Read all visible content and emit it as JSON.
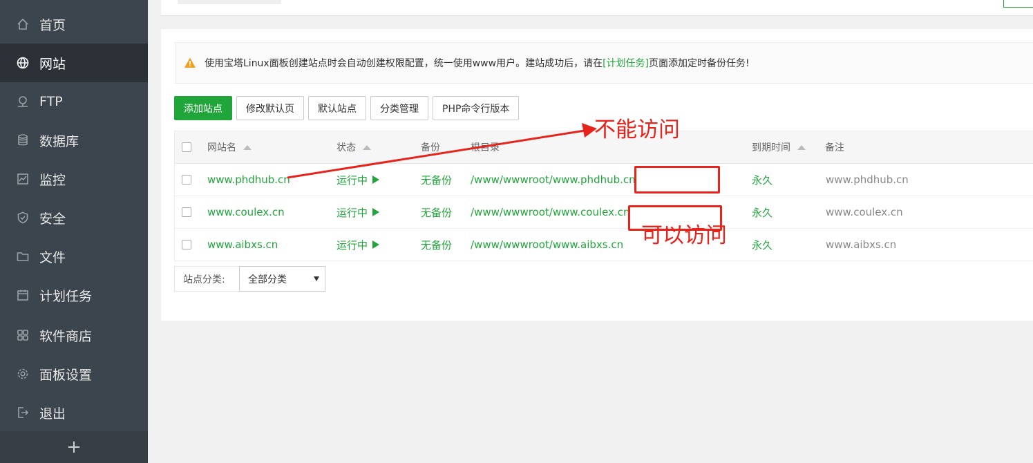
{
  "sidebar": {
    "items": [
      {
        "label": "首页",
        "icon": "home-icon"
      },
      {
        "label": "网站",
        "icon": "globe-icon",
        "active": true
      },
      {
        "label": "FTP",
        "icon": "ftp-icon"
      },
      {
        "label": "数据库",
        "icon": "database-icon"
      },
      {
        "label": "监控",
        "icon": "monitor-icon"
      },
      {
        "label": "安全",
        "icon": "shield-icon"
      },
      {
        "label": "文件",
        "icon": "folder-icon"
      },
      {
        "label": "计划任务",
        "icon": "calendar-icon"
      },
      {
        "label": "软件商店",
        "icon": "apps-icon"
      },
      {
        "label": "面板设置",
        "icon": "gear-icon"
      },
      {
        "label": "退出",
        "icon": "logout-icon"
      }
    ],
    "add_label": "+"
  },
  "notice": {
    "text_before": "使用宝塔Linux面板创建站点时会自动创建权限配置，统一使用www用户。建站成功后，请在",
    "link": "[计划任务]",
    "text_after": "页面添加定时备份任务!"
  },
  "toolbar": {
    "add_site": "添加站点",
    "modify_default_page": "修改默认页",
    "default_site": "默认站点",
    "category_manage": "分类管理",
    "php_cli_version": "PHP命令行版本"
  },
  "table": {
    "headers": {
      "name": "网站名",
      "status": "状态",
      "backup": "备份",
      "root": "根目录",
      "expire": "到期时间",
      "note": "备注"
    },
    "rows": [
      {
        "name": "www.phdhub.cn",
        "status": "运行中",
        "backup": "无备份",
        "root": "/www/wwwroot/www.phdhub.cn",
        "expire": "永久",
        "note": "www.phdhub.cn"
      },
      {
        "name": "www.coulex.cn",
        "status": "运行中",
        "backup": "无备份",
        "root": "/www/wwwroot/www.coulex.cn",
        "expire": "永久",
        "note": "www.coulex.cn"
      },
      {
        "name": "www.aibxs.cn",
        "status": "运行中",
        "backup": "无备份",
        "root": "/www/wwwroot/www.aibxs.cn",
        "expire": "永久",
        "note": "www.aibxs.cn"
      }
    ]
  },
  "category": {
    "label": "站点分类:",
    "selected": "全部分类"
  },
  "annotations": {
    "cannot_access": "不能访问",
    "can_access": "可以访问",
    "color": "#e8231b"
  },
  "colors": {
    "accent": "#20a53a",
    "sidebar_bg": "#3c444d"
  }
}
